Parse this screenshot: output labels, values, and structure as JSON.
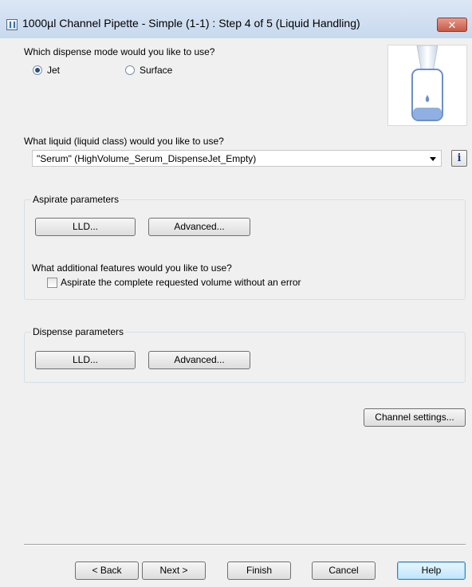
{
  "window": {
    "title": "1000µl Channel Pipette - Simple (1-1) : Step 4 of 5 (Liquid Handling)",
    "close_label": "✕"
  },
  "dispense_mode": {
    "question": "Which dispense mode would you like to use?",
    "options": [
      {
        "label": "Jet",
        "checked": true
      },
      {
        "label": "Surface",
        "checked": false
      }
    ]
  },
  "liquid": {
    "question": "What liquid (liquid class) would you like to use?",
    "selected": "\"Serum\"  (HighVolume_Serum_DispenseJet_Empty)",
    "info_label": "i"
  },
  "aspirate": {
    "caption": "Aspirate parameters",
    "lld_label": "LLD...",
    "advanced_label": "Advanced...",
    "features_question": "What additional features would you like to use?",
    "checkbox_label": "Aspirate the complete requested volume without an error",
    "checkbox_checked": false
  },
  "dispense": {
    "caption": "Dispense parameters",
    "lld_label": "LLD...",
    "advanced_label": "Advanced..."
  },
  "channel_settings_label": "Channel settings...",
  "footer": {
    "back_label": "< Back",
    "next_label": "Next >",
    "finish_label": "Finish",
    "cancel_label": "Cancel",
    "help_label": "Help"
  },
  "colors": {
    "title_bar": "#c8d9ee",
    "close": "#c45a45",
    "liquid": "#8fb0e0",
    "dialog_bg": "#f0f0f0"
  }
}
